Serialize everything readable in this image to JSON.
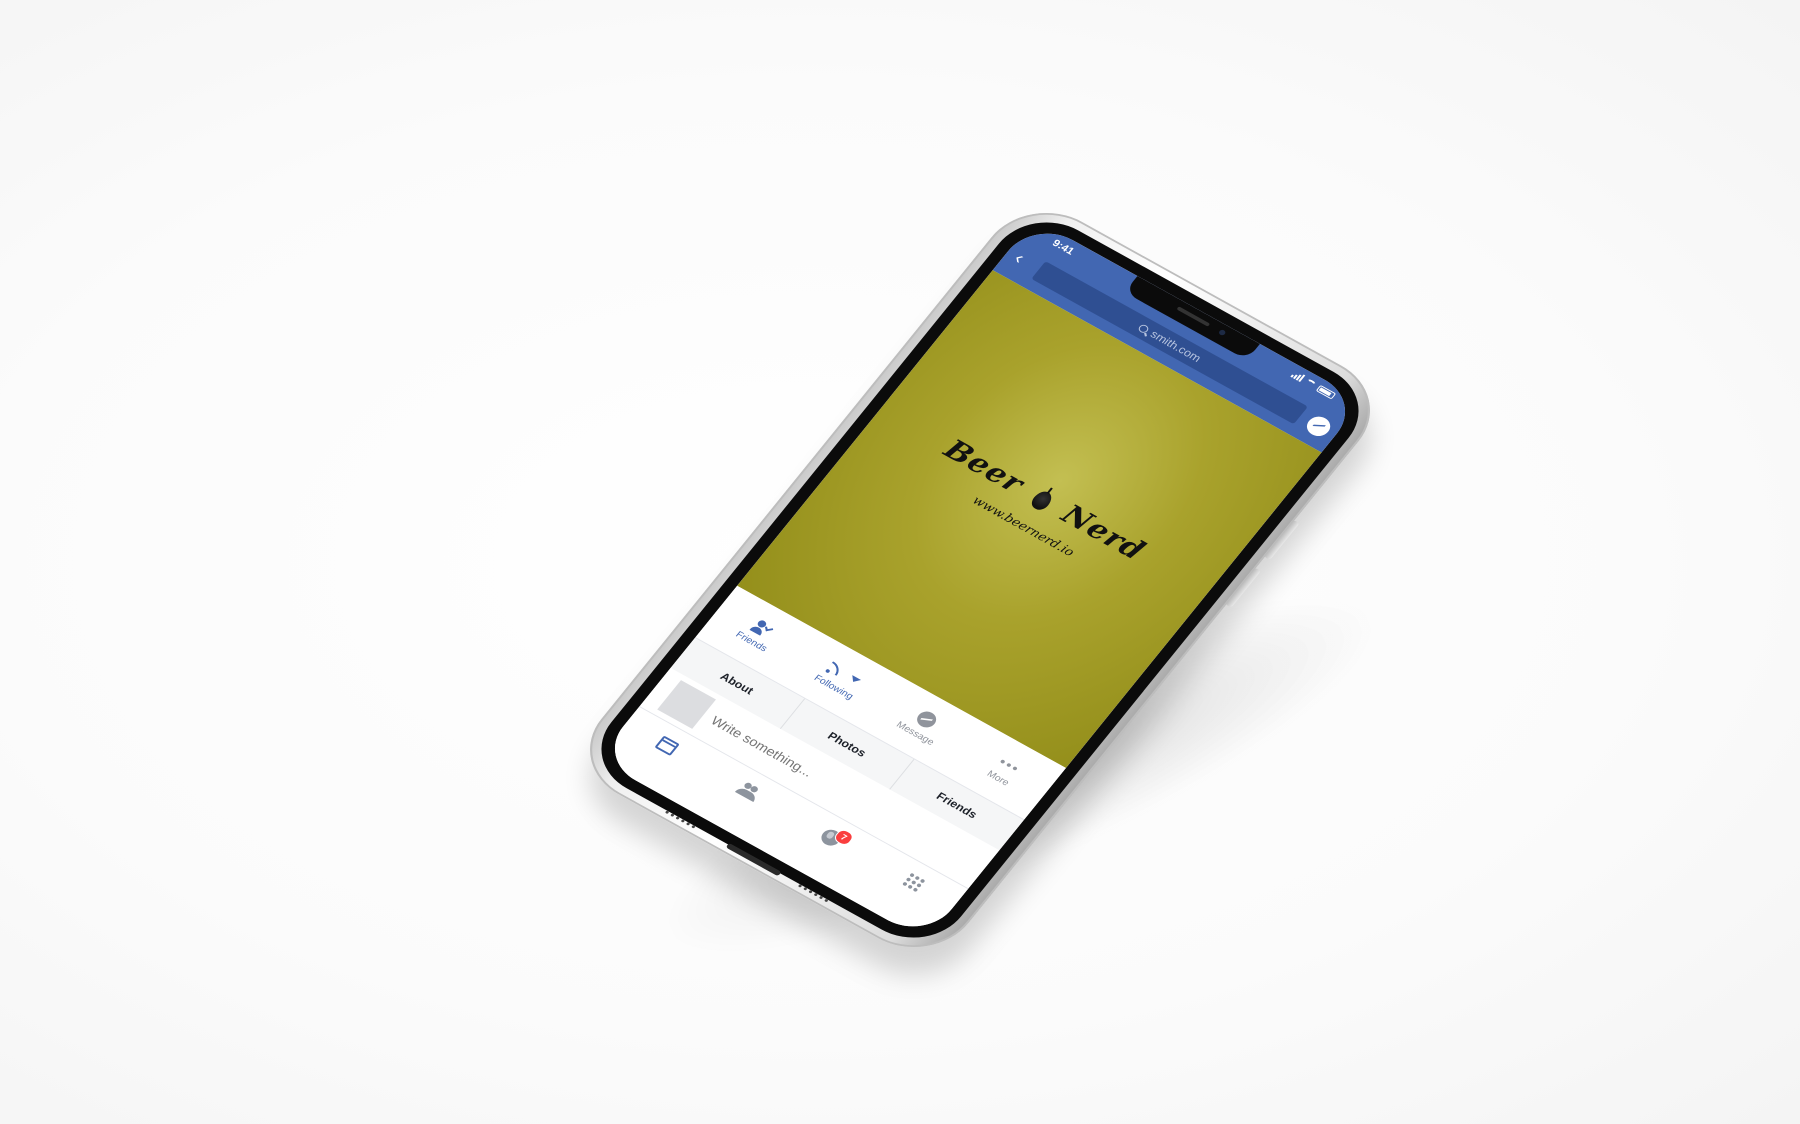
{
  "status_bar": {
    "time": "9:41"
  },
  "header": {
    "back_icon": "chevron-left-icon",
    "search_placeholder": "smith.com",
    "messenger_icon": "messenger-icon",
    "color": "#4267b2"
  },
  "cover": {
    "logo_left": "Beer",
    "logo_right": "Nerd",
    "logo_icon": "hop-icon",
    "url": "www.beernerd.io",
    "color": "#a9a22c"
  },
  "actions": [
    {
      "label": "Friends",
      "icon": "friends-check-icon"
    },
    {
      "label": "Following",
      "icon": "rss-icon"
    },
    {
      "label": "Message",
      "icon": "messenger-icon"
    },
    {
      "label": "More",
      "icon": "more-dots-icon"
    }
  ],
  "profile_tabs": [
    {
      "label": "About"
    },
    {
      "label": "Photos"
    },
    {
      "label": "Friends"
    }
  ],
  "composer": {
    "placeholder": "Write something..."
  },
  "bottom_nav": {
    "items": [
      {
        "icon": "news-feed-icon",
        "active": true
      },
      {
        "icon": "friends-icon",
        "active": false
      },
      {
        "icon": "globe-notifications-icon",
        "active": false,
        "badge": "7"
      },
      {
        "icon": "menu-grid-icon",
        "active": false
      }
    ]
  }
}
